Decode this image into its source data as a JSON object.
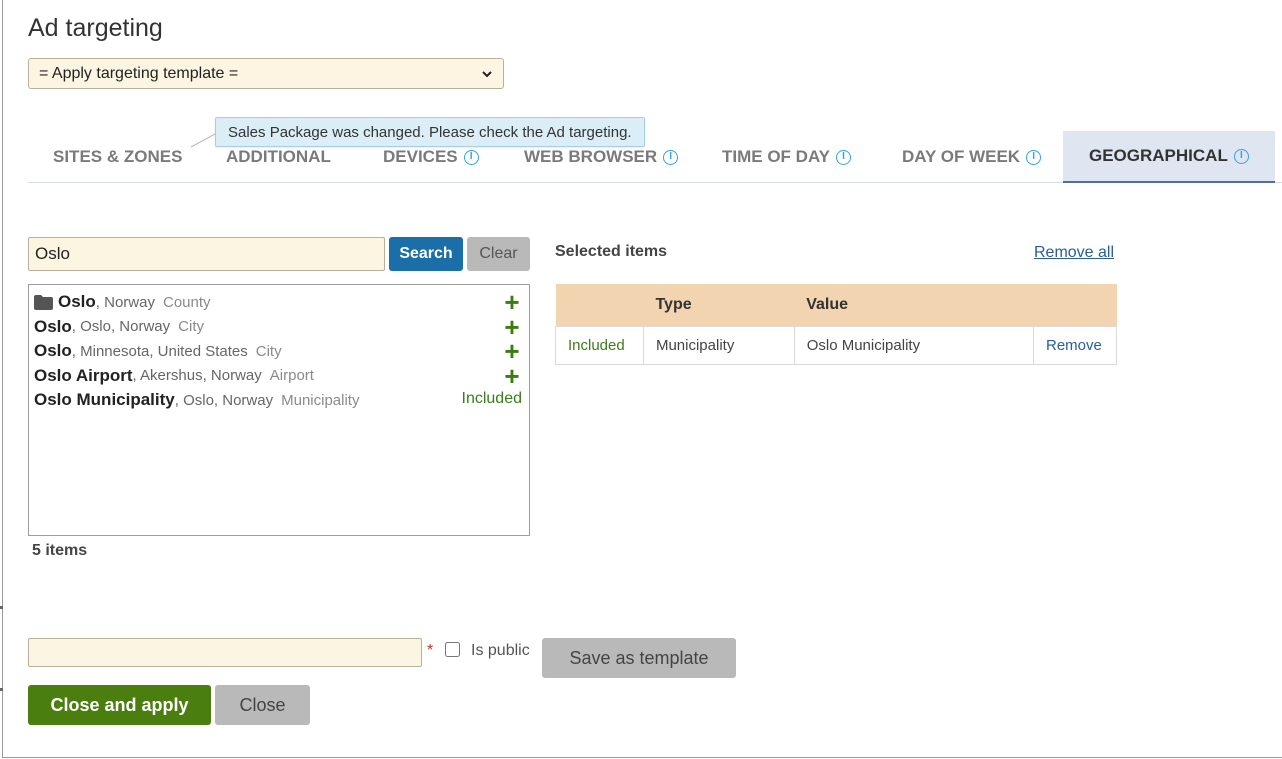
{
  "dialog": {
    "title": "Ad targeting"
  },
  "template_select": {
    "value": "= Apply targeting template ="
  },
  "notification": {
    "text": "Sales Package was changed. Please check the Ad targeting."
  },
  "tabs": [
    {
      "label": "SITES & ZONES",
      "info": false,
      "active": false
    },
    {
      "label": "ADDITIONAL",
      "info": false,
      "active": false
    },
    {
      "label": "DEVICES",
      "info": true,
      "active": false
    },
    {
      "label": "WEB BROWSER",
      "info": true,
      "active": false
    },
    {
      "label": "TIME OF DAY",
      "info": true,
      "active": false
    },
    {
      "label": "DAY OF WEEK",
      "info": true,
      "active": false
    },
    {
      "label": "GEOGRAPHICAL",
      "info": true,
      "active": true
    }
  ],
  "info_icon_glyph": "i",
  "search": {
    "value": "Oslo",
    "search_label": "Search",
    "clear_label": "Clear"
  },
  "results": [
    {
      "name": "Oslo",
      "location": ", Norway",
      "type": "County",
      "folder": true,
      "status": "add"
    },
    {
      "name": "Oslo",
      "location": ", Oslo, Norway",
      "type": "City",
      "folder": false,
      "status": "add"
    },
    {
      "name": "Oslo",
      "location": ", Minnesota, United States",
      "type": "City",
      "folder": false,
      "status": "add"
    },
    {
      "name": "Oslo Airport",
      "location": ", Akershus, Norway",
      "type": "Airport",
      "folder": false,
      "status": "add"
    },
    {
      "name": "Oslo Municipality",
      "location": ", Oslo, Norway",
      "type": "Municipality",
      "folder": false,
      "status": "Included"
    }
  ],
  "add_glyph": "+",
  "result_count": "5 items",
  "selected": {
    "title": "Selected items",
    "remove_all_label": "Remove all",
    "columns": [
      "",
      "Type",
      "Value",
      ""
    ],
    "rows": [
      {
        "status": "Included",
        "type": "Municipality",
        "value": "Oslo Municipality",
        "action": "Remove"
      }
    ]
  },
  "template_form": {
    "name_value": "",
    "required_mark": "*",
    "public_label": "Is public",
    "public_checked": false,
    "save_label": "Save as template"
  },
  "footer": {
    "close_apply_label": "Close and apply",
    "close_label": "Close"
  },
  "colors": {
    "primary": "#1a6fa8",
    "apply_green": "#4a7e0e",
    "included_green": "#3a7d1a",
    "input_bg": "#fcf5e1",
    "table_header": "#f3d4b0",
    "active_tab_bg": "#dfe6f1",
    "info_blue": "#33a2e0"
  }
}
